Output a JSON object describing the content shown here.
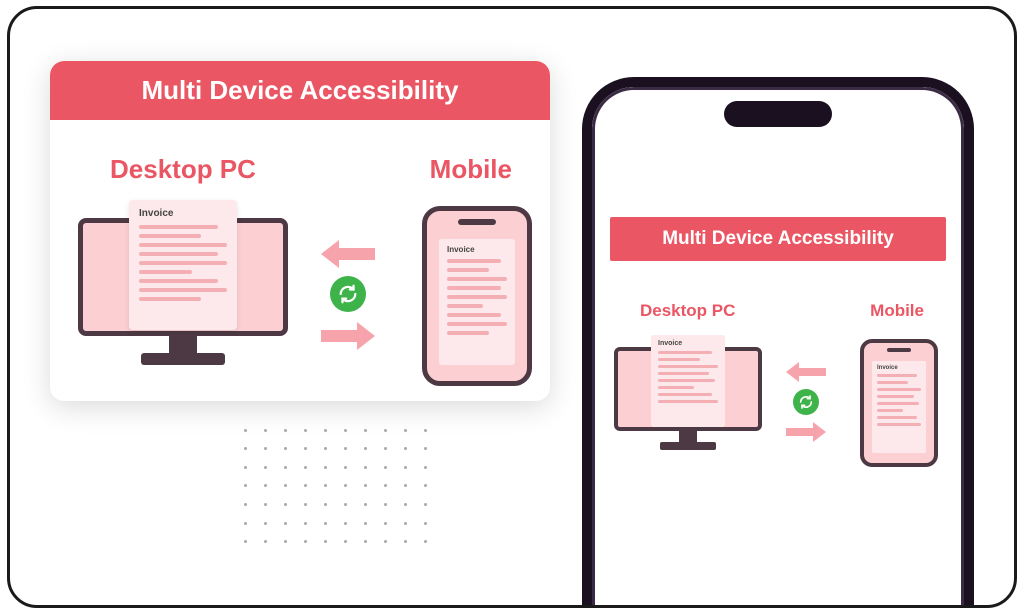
{
  "header_title": "Multi Device Accessibility",
  "labels": {
    "desktop": "Desktop PC",
    "mobile": "Mobile"
  },
  "document_label": "Invoice",
  "colors": {
    "accent": "#ea5663",
    "sync_green": "#3db34a",
    "device_outline": "#4d3943",
    "device_fill": "#fcd0d3",
    "doc_fill": "#fde9eb",
    "arrow": "#f7a3ab"
  }
}
